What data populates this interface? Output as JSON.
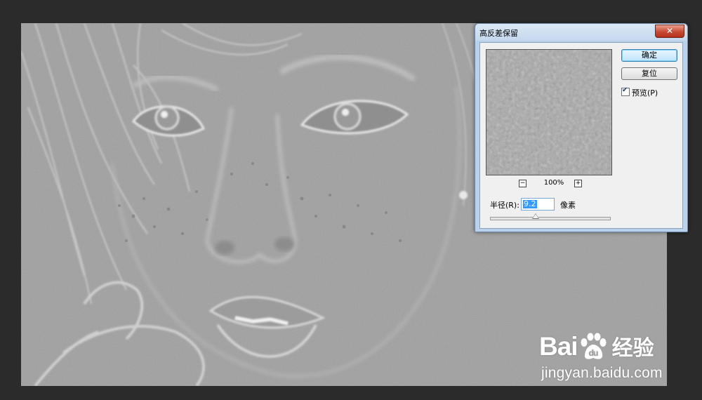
{
  "dialog": {
    "title": "高反差保留",
    "close_icon": "close-icon",
    "ok_label": "确定",
    "reset_label": "复位",
    "preview_label": "预览(P)",
    "preview_checked": true,
    "zoom_out": "−",
    "zoom_in": "+",
    "zoom_level": "100%",
    "radius_label": "半径(R):",
    "radius_value": "9.2",
    "radius_unit": "像素",
    "radius_slider_fraction": 0.38
  },
  "watermark": {
    "logo_left": "Bai",
    "logo_right": "经验",
    "logo_icon": "paw-icon",
    "url": "jingyan.baidu.com"
  },
  "colors": {
    "photo_gray": "#9e9e9e",
    "background": "#2b2b2b",
    "dialog_frame": "#b9d1ea",
    "close_red": "#c74a33"
  }
}
